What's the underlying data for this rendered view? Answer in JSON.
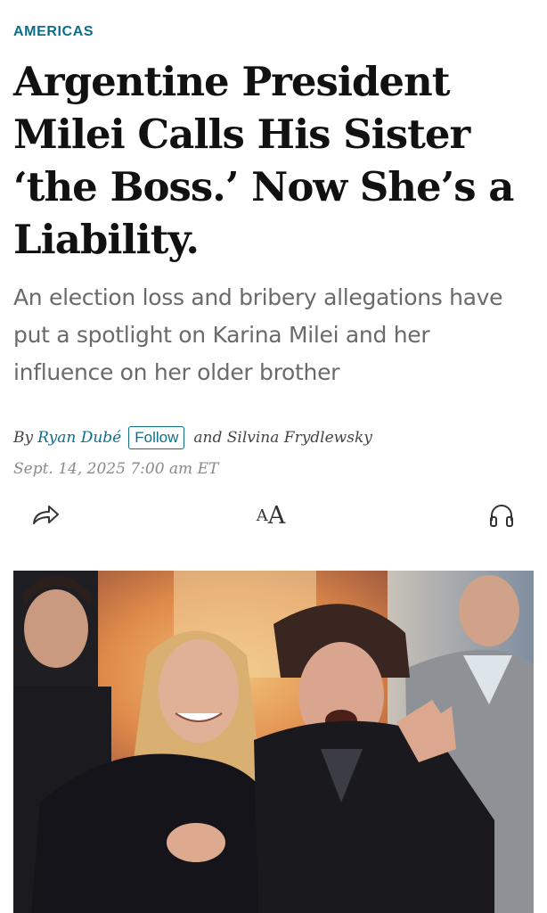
{
  "article": {
    "section": "AMERICAS",
    "headline": "Argentine President Milei Calls His Sister ‘the Boss.’ Now She’s a Liability.",
    "dek": "An election loss and bribery allegations have put a spotlight on Karina Milei and her influence on her older brother",
    "byline": {
      "prefix": "By",
      "author1": "Ryan Dubé",
      "follow_label": "Follow",
      "conjunction_author2": "and Silvina Frydlewsky"
    },
    "timestamp": "Sept. 14, 2025 7:00 am ET"
  },
  "toolbar": {
    "share_icon": "share-arrow-icon",
    "text_size_small": "A",
    "text_size_large": "A",
    "listen_icon": "headphones-icon"
  },
  "colors": {
    "accent": "#0c6e8c",
    "headline": "#111111",
    "dek": "#6a6a6a",
    "timestamp": "#8a8a8a"
  }
}
